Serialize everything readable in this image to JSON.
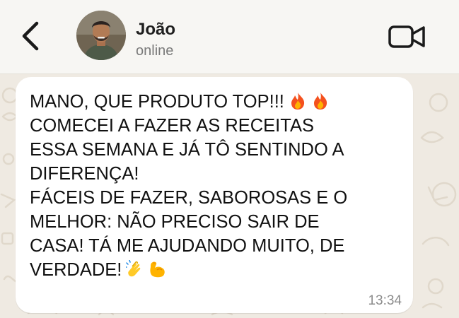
{
  "header": {
    "contact_name": "João",
    "status": "online",
    "back_icon": "chevron-left-icon",
    "video_icon": "video-camera-icon"
  },
  "message": {
    "lines": [
      "MANO, QUE PRODUTO TOP!!!",
      "COMECEI A FAZER AS RECEITAS",
      "ESSA SEMANA E JÁ TÔ SENTINDO A",
      "DIFERENÇA!",
      "FÁCEIS DE FAZER, SABOROSAS E O",
      "MELHOR: NÃO PRECISO SAIR DE",
      "CASA! TÁ ME AJUDANDO MUITO, DE",
      "VERDADE!"
    ],
    "emojis_line1": [
      "fire",
      "fire"
    ],
    "emojis_last_line": [
      "clapping-hands",
      "flexed-biceps"
    ],
    "time": "13:34"
  },
  "colors": {
    "chat_background": "#efeae2",
    "header_background": "#f7f6f3",
    "bubble": "#ffffff"
  }
}
